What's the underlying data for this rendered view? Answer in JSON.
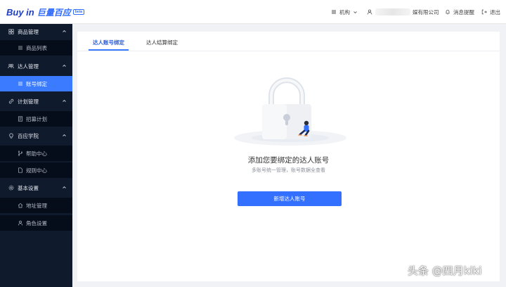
{
  "header": {
    "logo_buyin": "Buy in",
    "logo_brand": "巨量百应",
    "logo_badge": "beta",
    "org_label": "机构",
    "company_suffix": "媒有限公司",
    "notifications_label": "消息提醒",
    "logout_label": "退出"
  },
  "sidebar": {
    "groups": [
      {
        "label": "商品管理",
        "icon": "grid-icon",
        "items": [
          {
            "label": "商品列表",
            "icon": "list-icon"
          }
        ]
      },
      {
        "label": "达人管理",
        "icon": "users-icon",
        "items": [
          {
            "label": "账号绑定",
            "icon": "list-icon",
            "active": true
          }
        ]
      },
      {
        "label": "计划管理",
        "icon": "link-icon",
        "items": [
          {
            "label": "招募计划",
            "icon": "doc-icon"
          }
        ]
      },
      {
        "label": "百应学院",
        "icon": "bulb-icon",
        "items": [
          {
            "label": "帮助中心",
            "icon": "branch-icon"
          },
          {
            "label": "规则中心",
            "icon": "file-icon"
          }
        ]
      },
      {
        "label": "基本设置",
        "icon": "gear-icon",
        "items": [
          {
            "label": "地址管理",
            "icon": "home-icon"
          },
          {
            "label": "角色设置",
            "icon": "user-icon"
          }
        ]
      }
    ]
  },
  "main": {
    "tabs": [
      {
        "label": "达人账号绑定",
        "active": true
      },
      {
        "label": "达人结算绑定",
        "active": false
      }
    ],
    "empty_title": "添加您要绑定的达人账号",
    "empty_subtitle": "多账号统一管理，账号数据全查看",
    "add_button_label": "新增达人账号"
  },
  "watermark": "头条 @四月kiki",
  "colors": {
    "accent": "#3370ff",
    "sidebar_bg": "#0f1a2c",
    "sidebar_active": "#3a7bff"
  }
}
